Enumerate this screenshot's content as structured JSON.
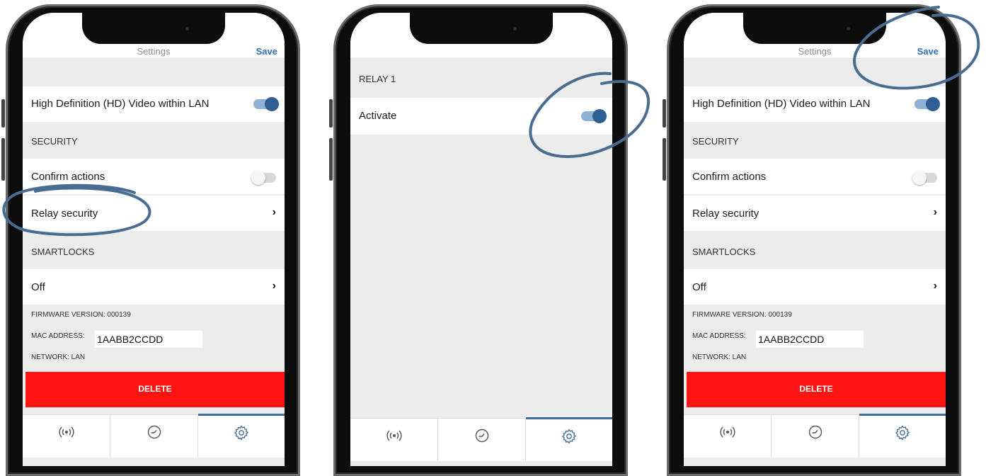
{
  "phones": [
    {
      "header": {
        "title": "Settings",
        "save": "Save"
      },
      "hd_label": "High Definition (HD) Video within LAN",
      "security_header": "SECURITY",
      "confirm_label": "Confirm actions",
      "relay_label": "Relay security",
      "smartlocks_header": "SMARTLOCKS",
      "smartlocks_value": "Off",
      "firmware": "FIRMWARE VERSION: 000139",
      "mac_label": "MAC ADDRESS:",
      "mac_value": "1AABB2CCDD",
      "network": "NETWORK: LAN",
      "delete": "DELETE",
      "toggles": {
        "hd": true,
        "confirm": false
      }
    },
    {
      "relay_header": "RELAY 1",
      "activate_label": "Activate",
      "toggles": {
        "activate": true
      }
    },
    {
      "header": {
        "title": "Settings",
        "save": "Save"
      },
      "hd_label": "High Definition (HD) Video within LAN",
      "security_header": "SECURITY",
      "confirm_label": "Confirm actions",
      "relay_label": "Relay security",
      "smartlocks_header": "SMARTLOCKS",
      "smartlocks_value": "Off",
      "firmware": "FIRMWARE VERSION: 000139",
      "mac_label": "MAC ADDRESS:",
      "mac_value": "1AABB2CCDD",
      "network": "NETWORK: LAN",
      "delete": "DELETE",
      "toggles": {
        "hd": true,
        "confirm": false
      }
    }
  ],
  "tabs": [
    {
      "icon": "broadcast-icon"
    },
    {
      "icon": "gauge-icon"
    },
    {
      "icon": "gear-icon",
      "active": true
    }
  ],
  "colors": {
    "accent": "#2f6eaf",
    "delete": "#ff1414",
    "annotation": "#4a6c91"
  }
}
